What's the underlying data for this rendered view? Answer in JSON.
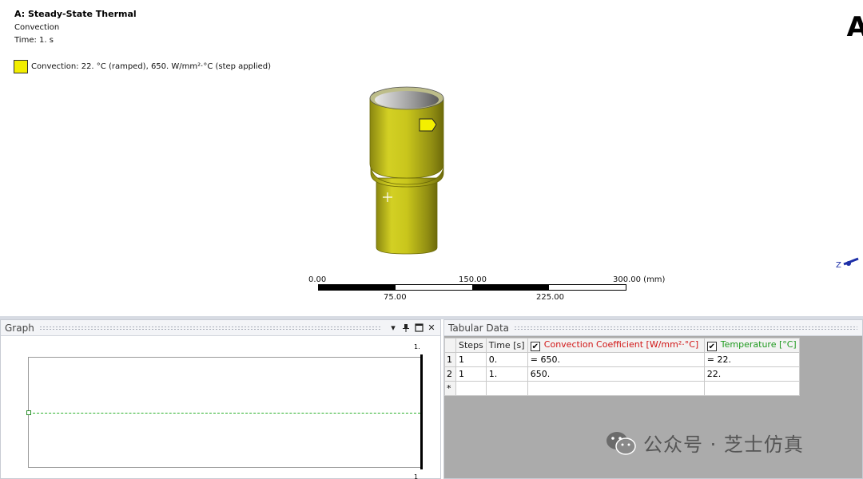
{
  "viewport": {
    "title": "A: Steady-State Thermal",
    "subtitle": "Convection",
    "time": "Time: 1. s",
    "legend": {
      "text": "Convection: 22. °C  (ramped), 650. W/mm²·°C  (step applied)",
      "color": "#f2ee00"
    },
    "logo_text": "A",
    "triad_label": "Z",
    "scale": {
      "top_labels": [
        "0.00",
        "150.00",
        "300.00 (mm)"
      ],
      "bottom_labels": [
        "75.00",
        "225.00"
      ]
    }
  },
  "graph_panel": {
    "title": "Graph",
    "icons": [
      "dropdown-icon",
      "pin-icon",
      "maximize-icon",
      "close-icon"
    ],
    "top_value": "1.",
    "bottom_value": "1"
  },
  "table_panel": {
    "title": "Tabular Data",
    "columns": [
      "Steps",
      "Time [s]",
      "Convection Coefficient [W/mm²·°C]",
      "Temperature [°C]"
    ],
    "rows": [
      [
        "1",
        "1",
        "0.",
        "= 650.",
        "= 22."
      ],
      [
        "2",
        "1",
        "1.",
        "650.",
        "22."
      ],
      [
        "*",
        "",
        "",
        "",
        ""
      ]
    ]
  },
  "watermark": {
    "text": "公众号 · 芝士仿真"
  },
  "colors": {
    "convection": "#d11515",
    "temperature": "#1f9a1f",
    "part": "#c8c51a"
  }
}
